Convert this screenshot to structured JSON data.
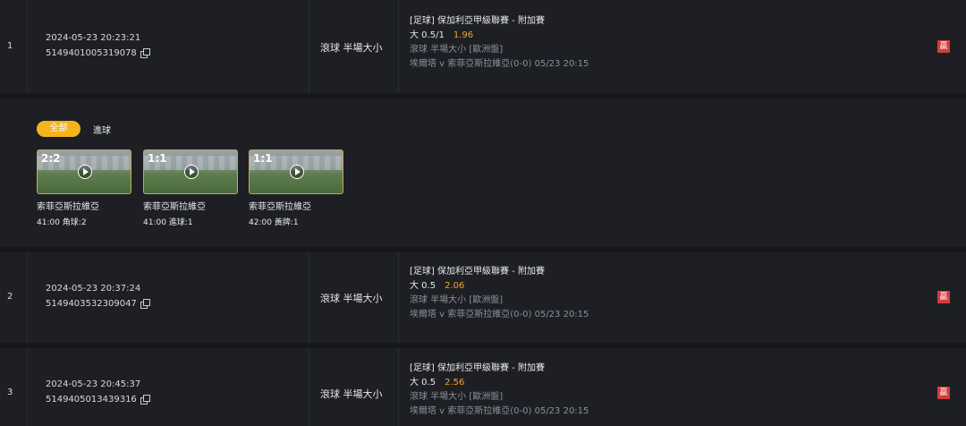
{
  "bets": [
    {
      "index": "1",
      "time": "2024-05-23 20:23:21",
      "order_id": "5149401005319078",
      "bet_type": "滾球  半場大小",
      "league": "[足球] 保加利亞甲級聯賽 - 附加賽",
      "pick": "大 0.5/1",
      "odds": "1.96",
      "sub": "滾球  半場大小  [歐洲盤]",
      "match": "埃爾塔 v 索菲亞斯拉維亞(0-0)    05/23 20:15",
      "result": "贏"
    },
    {
      "index": "2",
      "time": "2024-05-23 20:37:24",
      "order_id": "5149403532309047",
      "bet_type": "滾球  半場大小",
      "league": "[足球] 保加利亞甲級聯賽 - 附加賽",
      "pick": "大 0.5",
      "odds": "2.06",
      "sub": "滾球  半場大小  [歐洲盤]",
      "match": "埃爾塔 v 索菲亞斯拉維亞(0-0)    05/23 20:15",
      "result": "贏"
    },
    {
      "index": "3",
      "time": "2024-05-23 20:45:37",
      "order_id": "5149405013439316",
      "bet_type": "滾球  半場大小",
      "league": "[足球] 保加利亞甲級聯賽 - 附加賽",
      "pick": "大 0.5",
      "odds": "2.56",
      "sub": "滾球  半場大小  [歐洲盤]",
      "match": "埃爾塔 v 索菲亞斯拉維亞(0-0)    05/23 20:15",
      "result": "贏"
    }
  ],
  "highlights": {
    "filters": [
      "全部",
      "進球"
    ],
    "clips": [
      {
        "score": "2:2",
        "team": "索菲亞斯拉維亞",
        "event": "41:00 角球:2"
      },
      {
        "score": "1:1",
        "team": "索菲亞斯拉維亞",
        "event": "41:00 進球:1"
      },
      {
        "score": "1:1",
        "team": "索菲亞斯拉維亞",
        "event": "42:00 黃牌:1"
      }
    ]
  },
  "colors": {
    "accent": "#f5b41b",
    "odds": "#f5a623",
    "win_badge": "#d63b3b"
  }
}
